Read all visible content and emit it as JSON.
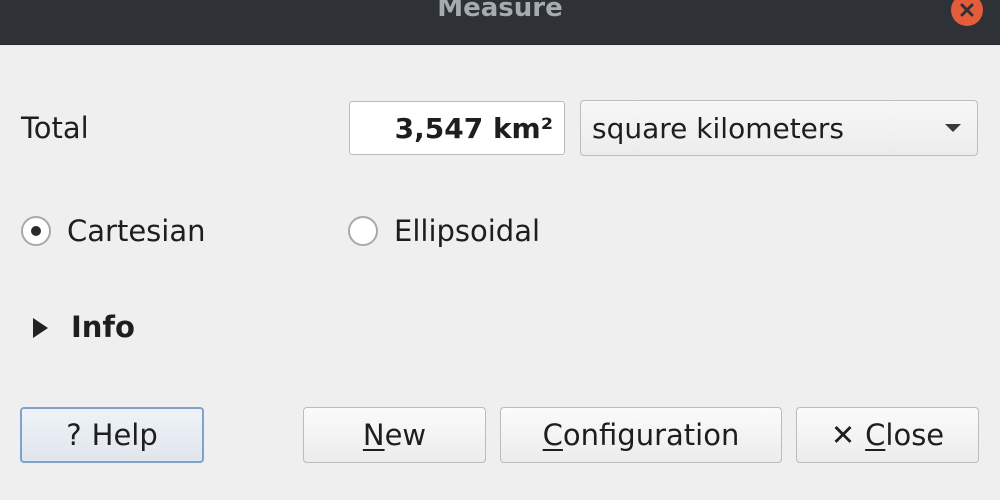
{
  "window": {
    "title": "Measure"
  },
  "total": {
    "label": "Total",
    "value": "3,547 km²",
    "unit_selected": "square kilometers"
  },
  "mode": {
    "options": [
      {
        "label": "Cartesian",
        "checked": true
      },
      {
        "label": "Ellipsoidal",
        "checked": false
      }
    ]
  },
  "info": {
    "label": "Info",
    "expanded": false
  },
  "buttons": {
    "help": {
      "glyph": "?",
      "label": "Help"
    },
    "new": {
      "mnemonic": "N",
      "rest": "ew"
    },
    "configuration": {
      "mnemonic": "C",
      "rest": "onfiguration"
    },
    "close": {
      "glyph": "✕",
      "mnemonic": "C",
      "rest": "lose"
    }
  },
  "colors": {
    "titlebar": "#2e3237",
    "close_button": "#e45c3a",
    "help_focus_border": "#7fa3c8",
    "background": "#efefef"
  }
}
